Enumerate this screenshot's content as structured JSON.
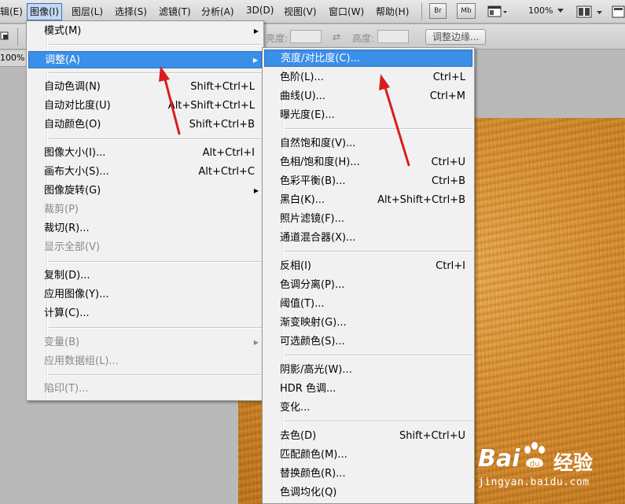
{
  "menubar": {
    "items": [
      "辑(E)",
      "图像(I)",
      "图层(L)",
      "选择(S)",
      "滤镜(T)",
      "分析(A)",
      "3D(D)",
      "视图(V)",
      "窗口(W)",
      "帮助(H)"
    ],
    "buttons": [
      "Br",
      "Mb"
    ],
    "zoom": "100%"
  },
  "options": {
    "brightness_label": "亮度:",
    "height_label": "高度:",
    "refine_button": "调整边缘...",
    "tab_zoom": "100%"
  },
  "image_menu": {
    "items": [
      {
        "label": "模式(M)",
        "shortcut": "",
        "submenu": true,
        "enabled": true
      },
      {
        "label": "调整(A)",
        "shortcut": "",
        "submenu": true,
        "enabled": true,
        "highlighted": true
      },
      {
        "label": "自动色调(N)",
        "shortcut": "Shift+Ctrl+L",
        "enabled": true
      },
      {
        "label": "自动对比度(U)",
        "shortcut": "Alt+Shift+Ctrl+L",
        "enabled": true
      },
      {
        "label": "自动颜色(O)",
        "shortcut": "Shift+Ctrl+B",
        "enabled": true
      },
      {
        "label": "图像大小(I)...",
        "shortcut": "Alt+Ctrl+I",
        "enabled": true
      },
      {
        "label": "画布大小(S)...",
        "shortcut": "Alt+Ctrl+C",
        "enabled": true
      },
      {
        "label": "图像旋转(G)",
        "shortcut": "",
        "submenu": true,
        "enabled": true
      },
      {
        "label": "裁剪(P)",
        "shortcut": "",
        "enabled": false
      },
      {
        "label": "裁切(R)...",
        "shortcut": "",
        "enabled": true
      },
      {
        "label": "显示全部(V)",
        "shortcut": "",
        "enabled": false
      },
      {
        "label": "复制(D)...",
        "shortcut": "",
        "enabled": true
      },
      {
        "label": "应用图像(Y)...",
        "shortcut": "",
        "enabled": true
      },
      {
        "label": "计算(C)...",
        "shortcut": "",
        "enabled": true
      },
      {
        "label": "变量(B)",
        "shortcut": "",
        "submenu": true,
        "enabled": false
      },
      {
        "label": "应用数据组(L)...",
        "shortcut": "",
        "enabled": false
      },
      {
        "label": "陷印(T)...",
        "shortcut": "",
        "enabled": false
      }
    ]
  },
  "adjust_menu": {
    "items": [
      {
        "label": "亮度/对比度(C)...",
        "shortcut": "",
        "highlighted": true
      },
      {
        "label": "色阶(L)...",
        "shortcut": "Ctrl+L"
      },
      {
        "label": "曲线(U)...",
        "shortcut": "Ctrl+M"
      },
      {
        "label": "曝光度(E)...",
        "shortcut": ""
      },
      {
        "label": "自然饱和度(V)...",
        "shortcut": ""
      },
      {
        "label": "色相/饱和度(H)...",
        "shortcut": "Ctrl+U"
      },
      {
        "label": "色彩平衡(B)...",
        "shortcut": "Ctrl+B"
      },
      {
        "label": "黑白(K)...",
        "shortcut": "Alt+Shift+Ctrl+B"
      },
      {
        "label": "照片滤镜(F)...",
        "shortcut": ""
      },
      {
        "label": "通道混合器(X)...",
        "shortcut": ""
      },
      {
        "label": "反相(I)",
        "shortcut": "Ctrl+I"
      },
      {
        "label": "色调分离(P)...",
        "shortcut": ""
      },
      {
        "label": "阈值(T)...",
        "shortcut": ""
      },
      {
        "label": "渐变映射(G)...",
        "shortcut": ""
      },
      {
        "label": "可选颜色(S)...",
        "shortcut": ""
      },
      {
        "label": "阴影/高光(W)...",
        "shortcut": ""
      },
      {
        "label": "HDR 色调...",
        "shortcut": ""
      },
      {
        "label": "变化...",
        "shortcut": ""
      },
      {
        "label": "去色(D)",
        "shortcut": "Shift+Ctrl+U"
      },
      {
        "label": "匹配颜色(M)...",
        "shortcut": ""
      },
      {
        "label": "替换颜色(R)...",
        "shortcut": ""
      },
      {
        "label": "色调均化(Q)",
        "shortcut": ""
      }
    ]
  },
  "watermark": {
    "brand": "Bai",
    "brand2": "du",
    "product": "经验",
    "url": "jingyan.baidu.com"
  },
  "colors": {
    "highlight": "#3a8fe8",
    "arrow": "#d81e1e",
    "wood": "#d48a2c"
  }
}
